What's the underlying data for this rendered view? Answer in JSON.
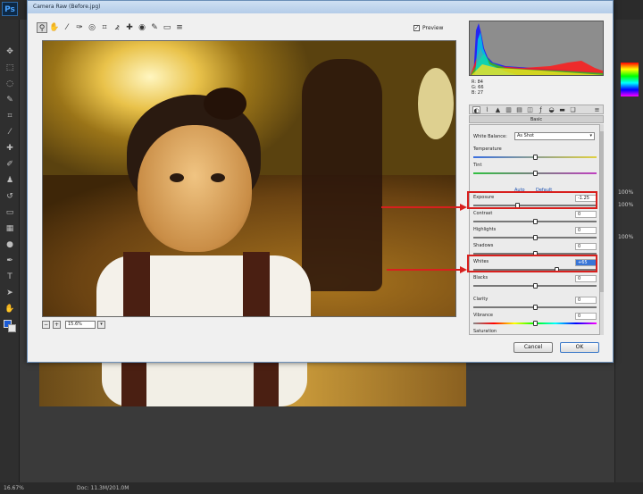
{
  "app": {
    "logo": "Ps"
  },
  "dialog": {
    "title": "Camera Raw (Before.jpg)",
    "preview_label": "Preview",
    "preview_checked": "✓",
    "zoom": "15.6%",
    "cancel_label": "Cancel",
    "ok_label": "OK"
  },
  "readout": {
    "r": "R: 84",
    "g": "G: 66",
    "b": "B: 27"
  },
  "panel": {
    "header": "Basic",
    "white_balance_label": "White Balance:",
    "white_balance_value": "As Shot",
    "auto_label": "Auto",
    "default_label": "Default",
    "sliders": [
      {
        "label": "Temperature",
        "value": "",
        "position": 0.5
      },
      {
        "label": "Tint",
        "value": "",
        "position": 0.5
      },
      {
        "label": "Exposure",
        "value": "-1.25",
        "position": 0.36
      },
      {
        "label": "Contrast",
        "value": "0",
        "position": 0.5
      },
      {
        "label": "Highlights",
        "value": "0",
        "position": 0.5
      },
      {
        "label": "Shadows",
        "value": "0",
        "position": 0.5
      },
      {
        "label": "Whites",
        "value": "+65",
        "position": 0.68
      },
      {
        "label": "Blacks",
        "value": "0",
        "position": 0.5
      },
      {
        "label": "Clarity",
        "value": "0",
        "position": 0.5
      },
      {
        "label": "Vibrance",
        "value": "0",
        "position": 0.5
      },
      {
        "label": "Saturation",
        "value": "",
        "position": 0.5
      }
    ]
  },
  "status": {
    "zoom": "16.67%",
    "doc": "Doc: 11.3M/201.0M"
  },
  "right_panel": {
    "label_a": "100%",
    "label_b": "100%",
    "label_c": "100%"
  },
  "colors": {
    "highlight": "#d8201e",
    "accent": "#3875d7"
  }
}
